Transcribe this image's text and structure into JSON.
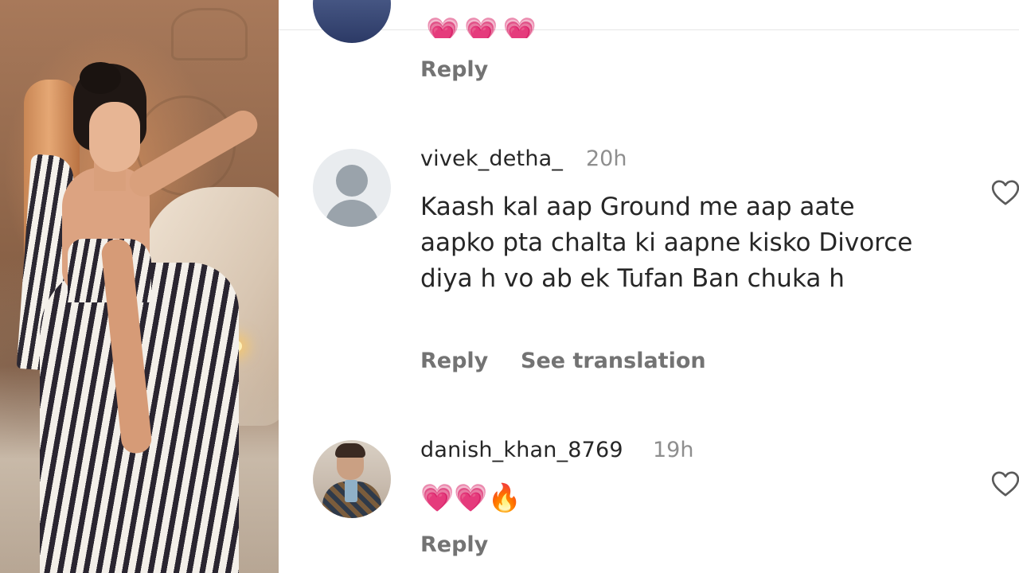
{
  "comments": [
    {
      "username": "",
      "timestamp": "",
      "text": "",
      "emojis": "💗💗💗",
      "reply_label": "Reply"
    },
    {
      "username": "vivek_detha_",
      "timestamp": "20h",
      "text": "Kaash kal aap Ground me aap aate aapko pta chalta ki aapne kisko Divorce diya h vo ab ek Tufan Ban chuka h",
      "reply_label": "Reply",
      "translate_label": "See translation",
      "avatar": "default-avatar-icon"
    },
    {
      "username": "danish_khan_8769",
      "timestamp": "19h",
      "emojis": "💗💗🔥",
      "reply_label": "Reply",
      "avatar": "user-photo"
    }
  ],
  "icons": {
    "like": "heart-outline-icon"
  },
  "colors": {
    "username": "#262626",
    "secondary": "#8e8e8e",
    "action": "#737373",
    "heart": "#f0325c"
  }
}
